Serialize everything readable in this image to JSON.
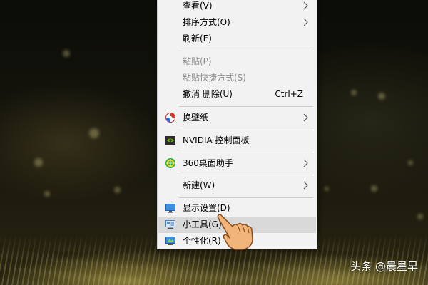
{
  "context_menu": {
    "items": [
      {
        "label": "查看(V)",
        "submenu": true
      },
      {
        "label": "排序方式(O)",
        "submenu": true
      },
      {
        "label": "刷新(E)"
      },
      {
        "label": "粘贴(P)",
        "disabled": true
      },
      {
        "label": "粘贴快捷方式(S)",
        "disabled": true
      },
      {
        "label": "撤消 删除(U)",
        "shortcut": "Ctrl+Z"
      },
      {
        "label": "换壁纸",
        "icon": "wallpaper-icon",
        "submenu": true
      },
      {
        "label": "NVIDIA 控制面板",
        "icon": "nvidia-icon"
      },
      {
        "label": "360桌面助手",
        "icon": "360-assistant-icon",
        "submenu": true
      },
      {
        "label": "新建(W)",
        "submenu": true
      },
      {
        "label": "显示设置(D)",
        "icon": "display-settings-icon"
      },
      {
        "label": "小工具(G)",
        "icon": "gadgets-icon",
        "highlighted": true
      },
      {
        "label": "个性化(R)",
        "icon": "personalize-icon"
      }
    ]
  },
  "watermark": "头条 @晨星早",
  "colors": {
    "menu_background": "#f2f2f2",
    "menu_highlight": "#d9d9d9",
    "disabled_text": "#8d8d8d"
  }
}
